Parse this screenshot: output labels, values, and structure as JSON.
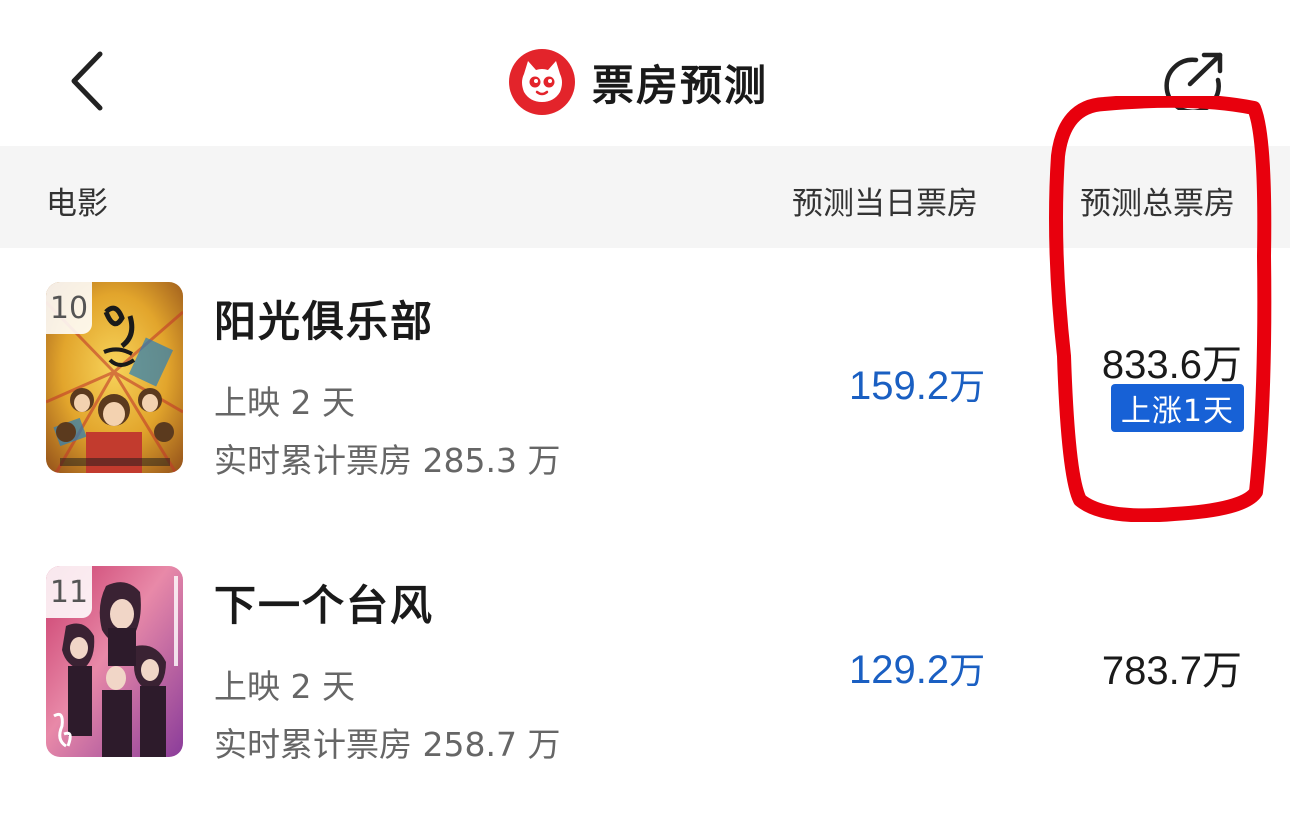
{
  "header": {
    "title": "票房预测",
    "back_icon": "chevron-left-icon",
    "share_icon": "share-icon",
    "logo_icon": "cat-logo-icon",
    "brand_color": "#e3242b"
  },
  "columns": {
    "movie": "电影",
    "daily": "预测当日票房",
    "total": "预测总票房"
  },
  "movies": [
    {
      "rank": "10",
      "title": "阳光俱乐部",
      "days": "上映 2 天",
      "cumulative": "实时累计票房 285.3 万",
      "daily_value": "159.2",
      "daily_unit": "万",
      "total": "833.6万",
      "badge": "上涨1天"
    },
    {
      "rank": "11",
      "title": "下一个台风",
      "days": "上映 2 天",
      "cumulative": "实时累计票房 258.7 万",
      "daily_value": "129.2",
      "daily_unit": "万",
      "total": "783.7万"
    }
  ],
  "colors": {
    "accent_blue": "#1a5fc2",
    "badge_blue": "#1761d6",
    "annotation_red": "#e8000d"
  }
}
